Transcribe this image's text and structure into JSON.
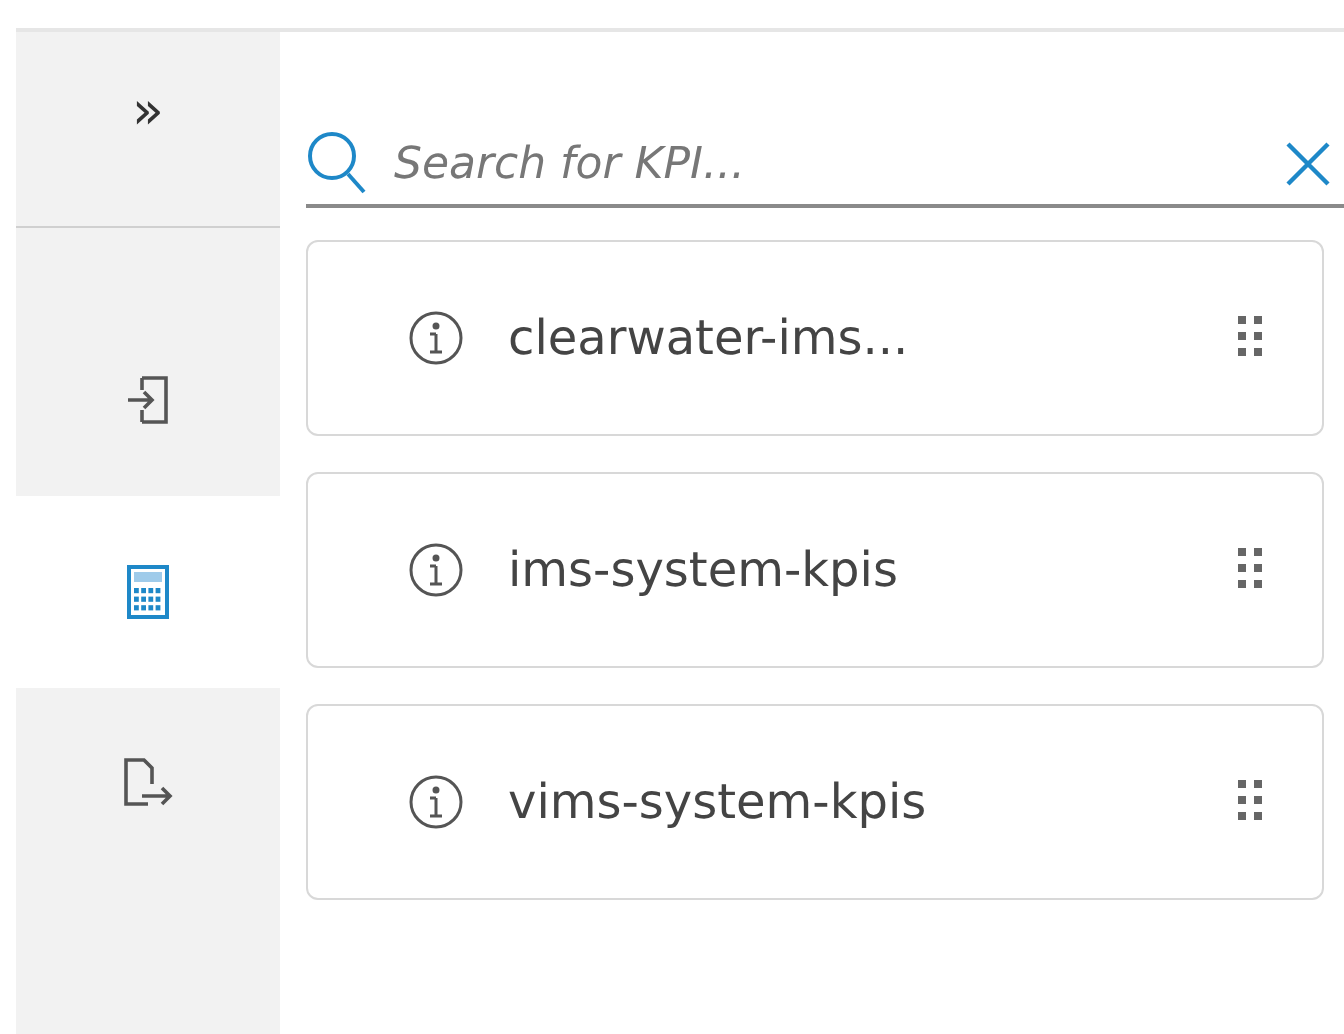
{
  "sidebar": {
    "collapse_label": "»",
    "items": [
      {
        "kind": "import",
        "selected": false
      },
      {
        "kind": "calculator",
        "selected": true
      },
      {
        "kind": "export",
        "selected": false
      }
    ]
  },
  "search": {
    "placeholder": "Search for KPI..."
  },
  "kpis": [
    {
      "name": "clearwater-ims..."
    },
    {
      "name": "ims-system-kpis"
    },
    {
      "name": "vims-system-kpis"
    }
  ]
}
